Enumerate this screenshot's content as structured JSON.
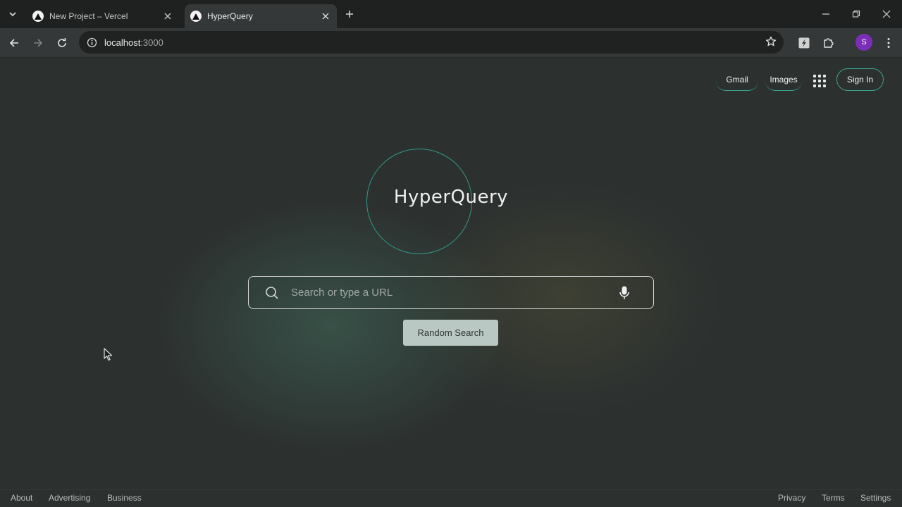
{
  "browser": {
    "tabs": [
      {
        "title": "New Project – Vercel",
        "active": false
      },
      {
        "title": "HyperQuery",
        "active": true
      }
    ],
    "address": {
      "host": "localhost",
      "port": ":3000"
    },
    "profile_initial": "S"
  },
  "header": {
    "links": [
      "Gmail",
      "Images"
    ],
    "apps_icon": "grid-icon",
    "signin_label": "Sign In"
  },
  "logo": {
    "text": "HyperQuery"
  },
  "search": {
    "placeholder": "Search or type a URL",
    "value": ""
  },
  "random_button": {
    "label": "Random Search"
  },
  "footer": {
    "left": [
      "About",
      "Advertising",
      "Business"
    ],
    "right": [
      "Privacy",
      "Terms",
      "Settings"
    ]
  },
  "colors": {
    "accent": "#3aa58d",
    "page_bg": "#2c302f",
    "button_bg": "#b9c8c2"
  }
}
